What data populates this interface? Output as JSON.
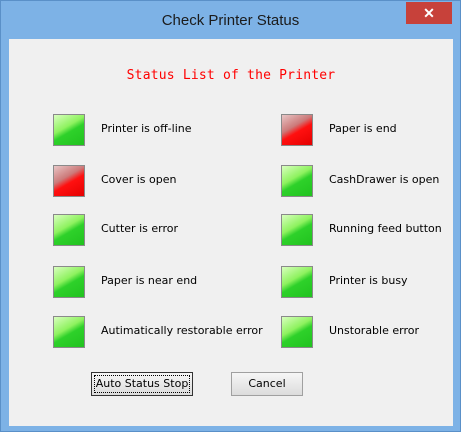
{
  "window": {
    "title": "Check Printer Status",
    "close_glyph": "✕"
  },
  "heading": "Status List of the Printer",
  "status_colors": {
    "ok": "#2ed12a",
    "error": "#ff0000"
  },
  "left_items": [
    {
      "label": "Printer is off-line",
      "state": "ok"
    },
    {
      "label": "Cover is open",
      "state": "error"
    },
    {
      "label": "Cutter is error",
      "state": "ok"
    },
    {
      "label": "Paper is near end",
      "state": "ok"
    },
    {
      "label": "Autimatically restorable error",
      "state": "ok"
    }
  ],
  "right_items": [
    {
      "label": "Paper is end",
      "state": "error"
    },
    {
      "label": "CashDrawer is open",
      "state": "ok"
    },
    {
      "label": "Running feed button",
      "state": "ok"
    },
    {
      "label": "Printer is busy",
      "state": "ok"
    },
    {
      "label": "Unstorable error",
      "state": "ok"
    }
  ],
  "buttons": {
    "auto_status_stop": "Auto Status Stop",
    "cancel": "Cancel"
  }
}
